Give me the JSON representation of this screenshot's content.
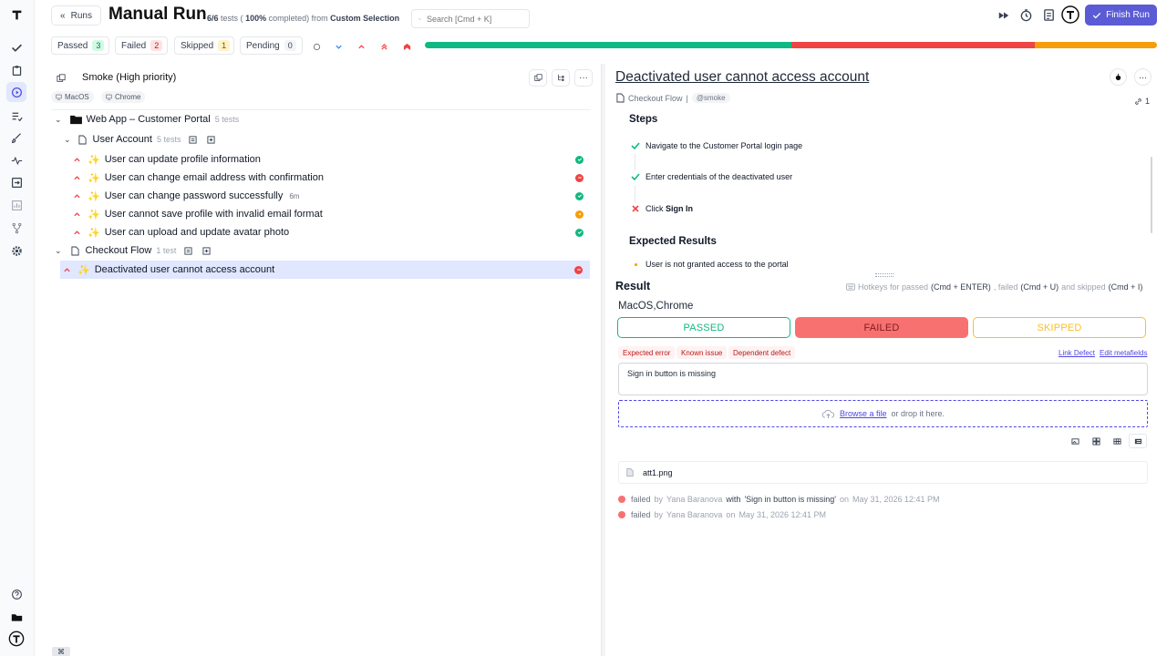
{
  "sidebar": {
    "icons": [
      "logo-icon",
      "check-icon",
      "clipboard-icon",
      "play-icon",
      "list-check-icon",
      "brush-icon",
      "pulse-icon",
      "import-icon",
      "chart-icon",
      "fork-icon",
      "gear-icon",
      "help-icon",
      "folder-icon",
      "avatar-icon"
    ]
  },
  "header": {
    "runs_button": "Runs",
    "title": "Manual Run",
    "progress_prefix": "6/6",
    "progress_mid": "tests (",
    "progress_percent": "100%",
    "progress_suffix": "completed) from",
    "selection": "Custom Selection",
    "search_placeholder": "Search [Cmd + K]",
    "finish_button": "Finish Run"
  },
  "filters": {
    "passed": {
      "label": "Passed",
      "count": "3"
    },
    "failed": {
      "label": "Failed",
      "count": "2"
    },
    "skipped": {
      "label": "Skipped",
      "count": "1"
    },
    "pending": {
      "label": "Pending",
      "count": "0"
    }
  },
  "progress_bar": {
    "passed_fraction": 0.5,
    "failed_fraction": 0.333,
    "skipped_fraction": 0.167,
    "colors": {
      "passed": "#10b981",
      "failed": "#ef4444",
      "skipped": "#f59e0b"
    }
  },
  "left_panel": {
    "plan_title": "Smoke (High priority)",
    "tags": [
      "MacOS",
      "Chrome"
    ],
    "suite": {
      "name": "Web App – Customer Portal",
      "count": "5 tests"
    },
    "groups": [
      {
        "name": "User Account",
        "count": "5 tests",
        "tests": [
          {
            "title": "User can update profile information",
            "status": "passed",
            "duration": ""
          },
          {
            "title": "User can change email address with confirmation",
            "status": "failed",
            "duration": ""
          },
          {
            "title": "User can change password successfully",
            "status": "passed",
            "duration": "6m"
          },
          {
            "title": "User cannot save profile with invalid email format",
            "status": "skipped",
            "duration": ""
          },
          {
            "title": "User can upload and update avatar photo",
            "status": "passed",
            "duration": ""
          }
        ]
      },
      {
        "name": "Checkout Flow",
        "count": "1 test",
        "tests": [
          {
            "title": "Deactivated user cannot access account",
            "status": "failed",
            "duration": ""
          }
        ]
      }
    ]
  },
  "detail": {
    "title": "Deactivated user cannot access account",
    "breadcrumb": "Checkout Flow",
    "separator": "|",
    "tag": "@smoke",
    "links_count": "1",
    "steps_heading": "Steps",
    "steps": [
      {
        "text": "Navigate to the Customer Portal login page",
        "status": "passed"
      },
      {
        "text": "Enter credentials of the deactivated user",
        "status": "passed"
      },
      {
        "text_prefix": "Click ",
        "text_bold": "Sign In",
        "status": "failed"
      }
    ],
    "expected_heading": "Expected Results",
    "expected": [
      "User is not granted access to the portal"
    ]
  },
  "result": {
    "heading": "Result",
    "hotkeys": {
      "prefix": "Hotkeys for passed",
      "passed": "(Cmd + ENTER)",
      "failed_label": ", failed",
      "failed": "(Cmd + U)",
      "skipped_label": "and skipped",
      "skipped": "(Cmd + I)"
    },
    "env": "MacOS,Chrome",
    "buttons": {
      "passed": "PASSED",
      "failed": "FAILED",
      "skipped": "SKIPPED"
    },
    "error_tags": [
      "Expected error",
      "Known issue",
      "Dependent defect"
    ],
    "link_defect": "Link Defect",
    "edit_metafields": "Edit metafields",
    "message": "Sign in button is missing",
    "upload": {
      "link": "Browse a file",
      "text": "or drop it here."
    },
    "attachment": "att1.png",
    "history": [
      {
        "status": "failed",
        "by": "by",
        "user": "Yana Baranova",
        "with": "with",
        "msg": "'Sign in button is missing'",
        "on": "on",
        "date": "May 31, 2026 12:41 PM"
      },
      {
        "status": "failed",
        "by": "by",
        "user": "Yana Baranova",
        "with": "",
        "msg": "",
        "on": "on",
        "date": "May 31, 2026 12:41 PM"
      }
    ]
  },
  "bottom": {
    "shortcut_icon": "command-icon"
  }
}
